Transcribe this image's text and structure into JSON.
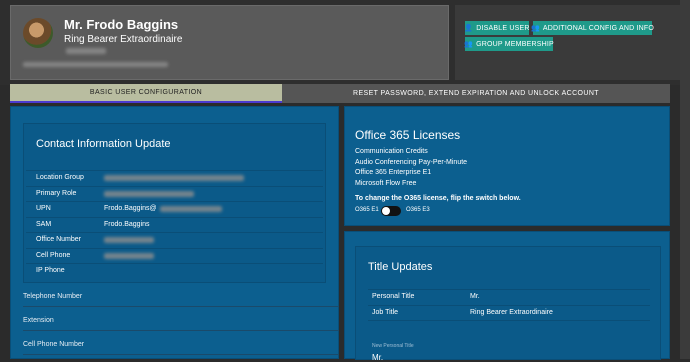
{
  "profile": {
    "name": "Mr. Frodo Baggins",
    "title": "Ring Bearer Extraordinaire"
  },
  "actions": {
    "disable": "DISABLE USER",
    "additional": "ADDITIONAL CONFIG AND INFO",
    "group": "GROUP MEMBERSHIP"
  },
  "tabs": {
    "basic": "BASIC USER CONFIGURATION",
    "reset": "RESET PASSWORD, EXTEND EXPIRATION AND UNLOCK ACCOUNT"
  },
  "contact": {
    "heading": "Contact Information Update",
    "rows": [
      {
        "label": "Location Group",
        "value": ""
      },
      {
        "label": "Primary Role",
        "value": ""
      },
      {
        "label": "UPN",
        "value": "Frodo.Baggins@"
      },
      {
        "label": "SAM",
        "value": "Frodo.Baggins"
      },
      {
        "label": "Office Number",
        "value": ""
      },
      {
        "label": "Cell Phone",
        "value": ""
      },
      {
        "label": "IP Phone",
        "value": ""
      }
    ],
    "fields": [
      "Telephone Number",
      "Extension",
      "Cell Phone Number"
    ]
  },
  "licenses": {
    "heading": "Office 365 Licenses",
    "items": [
      "Communication Credits",
      "Audio Conferencing Pay-Per-Minute",
      "Office 365 Enterprise E1",
      "Microsoft Flow Free"
    ],
    "hint": "To change the O365 license, flip the switch below.",
    "e1": "O365 E1",
    "e3": "O365 E3"
  },
  "title_updates": {
    "heading": "Title Updates",
    "rows": [
      {
        "label": "Personal Title",
        "value": "Mr."
      },
      {
        "label": "Job Title",
        "value": "Ring Bearer Extraordinaire"
      }
    ],
    "new_label": "New Personal Title",
    "new_value": "Mr."
  }
}
